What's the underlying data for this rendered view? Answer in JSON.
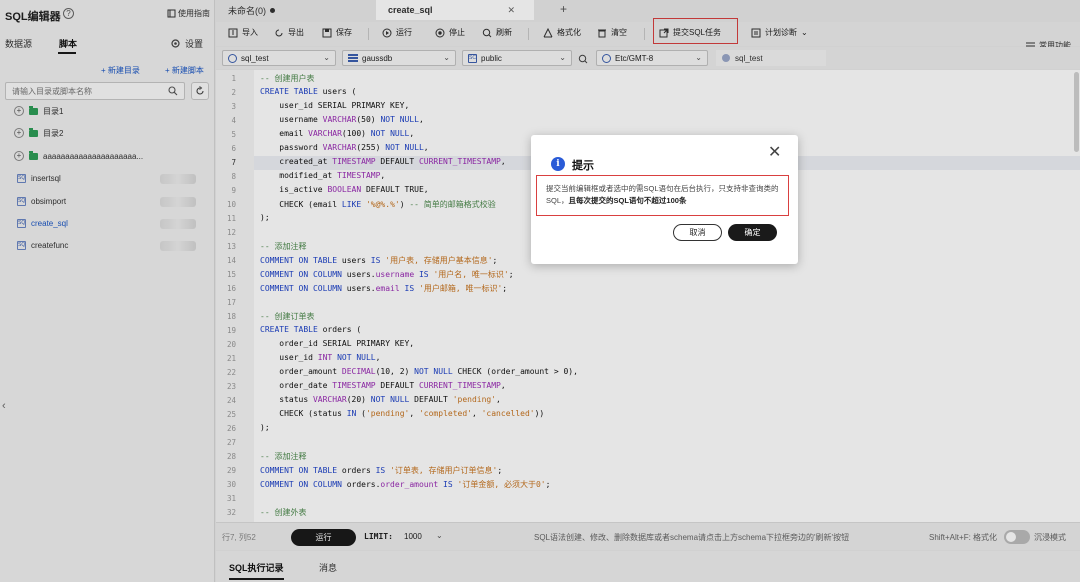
{
  "sidebar": {
    "title": "SQL编辑器",
    "help_icon": "?",
    "guide_label": "使用指南",
    "tabs": [
      "数据源",
      "脚本"
    ],
    "settings_label": "设置",
    "new_dir_label": "+ 新建目录",
    "new_script_label": "+ 新建脚本",
    "search_placeholder": "请输入目录或脚本名称",
    "tree": [
      {
        "label": "目录1",
        "type": "folder"
      },
      {
        "label": "目录2",
        "type": "folder"
      },
      {
        "label": "aaaaaaaaaaaaaaaaaaaaa...",
        "type": "folder"
      }
    ],
    "scripts": [
      {
        "label": "insertsql"
      },
      {
        "label": "obsimport"
      },
      {
        "label": "create_sql",
        "active": true
      },
      {
        "label": "createfunc"
      }
    ],
    "collapse_glyph": "‹"
  },
  "tabs": [
    {
      "label": "未命名(0)"
    },
    {
      "label": "create_sql",
      "close": "✕"
    }
  ],
  "tab_add": "+",
  "toolbar": {
    "import": "导入",
    "export": "导出",
    "save": "保存",
    "run": "运行",
    "stop": "停止",
    "refresh": "刷新",
    "format": "格式化",
    "clear": "清空",
    "submit_sql_task": "提交SQL任务",
    "plan_diag": "计划诊断",
    "common_functions": "常用功能"
  },
  "selectors": {
    "connection": "sql_test",
    "database": "gaussdb",
    "schema": "public",
    "timezone": "Etc/GMT-8",
    "user": "sql_test"
  },
  "editor": {
    "current_line": 7,
    "lines": [
      [
        [
          "cm",
          "-- 创建用户表"
        ]
      ],
      [
        [
          "kw",
          "CREATE TABLE"
        ],
        [
          "",
          " users ("
        ]
      ],
      [
        [
          "",
          "    user_id SERIAL PRIMARY KEY,"
        ]
      ],
      [
        [
          "",
          "    username "
        ],
        [
          "ty",
          "VARCHAR"
        ],
        [
          "",
          "(50) "
        ],
        [
          "kw",
          "NOT NULL"
        ],
        [
          "",
          ","
        ]
      ],
      [
        [
          "",
          "    email "
        ],
        [
          "ty",
          "VARCHAR"
        ],
        [
          "",
          "(100) "
        ],
        [
          "kw",
          "NOT NULL"
        ],
        [
          "",
          ","
        ]
      ],
      [
        [
          "",
          "    password "
        ],
        [
          "ty",
          "VARCHAR"
        ],
        [
          "",
          "(255) "
        ],
        [
          "kw",
          "NOT NULL"
        ],
        [
          "",
          ","
        ]
      ],
      [
        [
          "",
          "    created_at "
        ],
        [
          "ty",
          "TIMESTAMP"
        ],
        [
          "",
          " DEFAULT "
        ],
        [
          "cn",
          "CURRENT_TIMESTAMP"
        ],
        [
          "",
          ","
        ]
      ],
      [
        [
          "",
          "    modified_at "
        ],
        [
          "ty",
          "TIMESTAMP"
        ],
        [
          "",
          ","
        ]
      ],
      [
        [
          "",
          "    is_active "
        ],
        [
          "ty",
          "BOOLEAN"
        ],
        [
          "",
          " DEFAULT TRUE,"
        ]
      ],
      [
        [
          "",
          "    CHECK (email "
        ],
        [
          "kw",
          "LIKE"
        ],
        [
          "",
          " "
        ],
        [
          "str",
          "'%@%.%'"
        ],
        [
          "",
          ") "
        ],
        [
          "cm",
          "-- 简单的邮箱格式校验"
        ]
      ],
      [
        [
          "",
          ");"
        ]
      ],
      [
        [
          "",
          ""
        ]
      ],
      [
        [
          "cm",
          "-- 添加注释"
        ]
      ],
      [
        [
          "kw",
          "COMMENT ON TABLE"
        ],
        [
          "",
          " users "
        ],
        [
          "kw",
          "IS"
        ],
        [
          "",
          " "
        ],
        [
          "str",
          "'用户表, 存储用户基本信息'"
        ],
        [
          "",
          ";"
        ]
      ],
      [
        [
          "kw",
          "COMMENT ON COLUMN"
        ],
        [
          "",
          " users."
        ],
        [
          "ty",
          "username"
        ],
        [
          "",
          " "
        ],
        [
          "kw",
          "IS"
        ],
        [
          "",
          " "
        ],
        [
          "str",
          "'用户名, 唯一标识'"
        ],
        [
          "",
          ";"
        ]
      ],
      [
        [
          "kw",
          "COMMENT ON COLUMN"
        ],
        [
          "",
          " users."
        ],
        [
          "ty",
          "email"
        ],
        [
          "",
          " "
        ],
        [
          "kw",
          "IS"
        ],
        [
          "",
          " "
        ],
        [
          "str",
          "'用户邮箱, 唯一标识'"
        ],
        [
          "",
          ";"
        ]
      ],
      [
        [
          "",
          ""
        ]
      ],
      [
        [
          "cm",
          "-- 创建订单表"
        ]
      ],
      [
        [
          "kw",
          "CREATE TABLE"
        ],
        [
          "",
          " orders ("
        ]
      ],
      [
        [
          "",
          "    order_id SERIAL PRIMARY KEY,"
        ]
      ],
      [
        [
          "",
          "    user_id "
        ],
        [
          "ty",
          "INT"
        ],
        [
          "",
          " "
        ],
        [
          "kw",
          "NOT NULL"
        ],
        [
          "",
          ","
        ]
      ],
      [
        [
          "",
          "    order_amount "
        ],
        [
          "ty",
          "DECIMAL"
        ],
        [
          "",
          "(10, 2) "
        ],
        [
          "kw",
          "NOT NULL"
        ],
        [
          "",
          " CHECK (order_amount > 0),"
        ]
      ],
      [
        [
          "",
          "    order_date "
        ],
        [
          "ty",
          "TIMESTAMP"
        ],
        [
          "",
          " DEFAULT "
        ],
        [
          "cn",
          "CURRENT_TIMESTAMP"
        ],
        [
          "",
          ","
        ]
      ],
      [
        [
          "",
          "    status "
        ],
        [
          "ty",
          "VARCHAR"
        ],
        [
          "",
          "(20) "
        ],
        [
          "kw",
          "NOT NULL"
        ],
        [
          "",
          " DEFAULT "
        ],
        [
          "str",
          "'pending'"
        ],
        [
          "",
          ","
        ]
      ],
      [
        [
          "",
          "    CHECK (status "
        ],
        [
          "kw",
          "IN"
        ],
        [
          "",
          " ("
        ],
        [
          "str",
          "'pending'"
        ],
        [
          "",
          ", "
        ],
        [
          "str",
          "'completed'"
        ],
        [
          "",
          ", "
        ],
        [
          "str",
          "'cancelled'"
        ],
        [
          "",
          "))"
        ]
      ],
      [
        [
          "",
          ");"
        ]
      ],
      [
        [
          "",
          ""
        ]
      ],
      [
        [
          "cm",
          "-- 添加注释"
        ]
      ],
      [
        [
          "kw",
          "COMMENT ON TABLE"
        ],
        [
          "",
          " orders "
        ],
        [
          "kw",
          "IS"
        ],
        [
          "",
          " "
        ],
        [
          "str",
          "'订单表, 存储用户订单信息'"
        ],
        [
          "",
          ";"
        ]
      ],
      [
        [
          "kw",
          "COMMENT ON COLUMN"
        ],
        [
          "",
          " orders."
        ],
        [
          "ty",
          "order_amount"
        ],
        [
          "",
          " "
        ],
        [
          "kw",
          "IS"
        ],
        [
          "",
          " "
        ],
        [
          "str",
          "'订单金额, 必须大于0'"
        ],
        [
          "",
          ";"
        ]
      ],
      [
        [
          "",
          ""
        ]
      ],
      [
        [
          "cm",
          "-- 创建外表"
        ]
      ]
    ]
  },
  "bottom": {
    "position": "行7, 列52",
    "run": "运行",
    "limit_label": "LIMIT:",
    "limit_value": "1000",
    "hint": "SQL语法创建、修改、删除数据库或者schema请点击上方schema下拉框旁边的'刷新'按钮",
    "shortcut": "Shift+Alt+F: 格式化",
    "immersive": "沉浸模式"
  },
  "result_tabs": [
    "SQL执行记录",
    "消息"
  ],
  "dialog": {
    "title": "提示",
    "info_glyph": "i",
    "close": "✕",
    "text_normal": "提交当前编辑框或者选中的需SQL语句在后台执行，只支持非查询类的SQL，",
    "text_bold": "且每次提交的SQL语句不超过100条",
    "cancel": "取消",
    "confirm": "确定"
  },
  "colors": {
    "keyword": "#1f43c9",
    "type": "#9a2bb5",
    "string": "#c8741f",
    "comment": "#4d8a4d",
    "highlight_border": "#d94040",
    "primary_button": "#1a1a1a",
    "link": "#1a56c4"
  }
}
